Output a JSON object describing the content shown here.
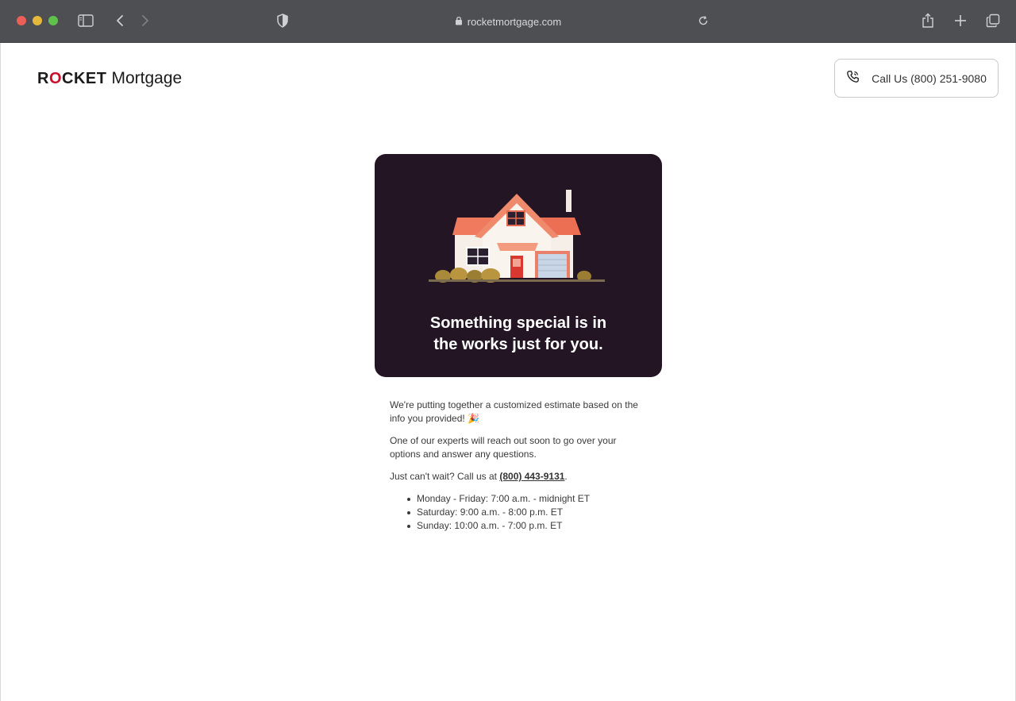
{
  "browser": {
    "url": "rocketmortgage.com",
    "icons": {
      "sidebar": "sidebar-icon",
      "back": "chevron-left-icon",
      "forward": "chevron-right-icon",
      "shield": "shield-icon",
      "lock": "lock-icon",
      "reload": "reload-icon",
      "share": "share-icon",
      "new_tab": "plus-icon",
      "tabs": "tabs-icon"
    }
  },
  "header": {
    "logo_rocket_r": "R",
    "logo_rocket_o": "O",
    "logo_rocket_rest": "CKET",
    "logo_mortgage": "Mortgage",
    "call_button_label": "Call Us (800) 251-9080"
  },
  "hero": {
    "line1": "Something special is in",
    "line2": "the works just for you."
  },
  "content": {
    "para1": "We're putting together a customized estimate based on the info you provided! 🎉",
    "para2": "One of our experts will reach out soon to go over your options and answer any questions.",
    "para3_prefix": "Just can't wait? Call us at ",
    "para3_phone": "(800) 443-9131",
    "para3_suffix": ".",
    "hours": [
      "Monday - Friday: 7:00 a.m. - midnight ET",
      "Saturday: 9:00 a.m. - 8:00 p.m. ET",
      "Sunday: 10:00 a.m. - 7:00 p.m. ET"
    ]
  },
  "colors": {
    "brand_red": "#c8102e",
    "hero_bg": "#231523",
    "chrome_bg": "#4d4f53"
  }
}
